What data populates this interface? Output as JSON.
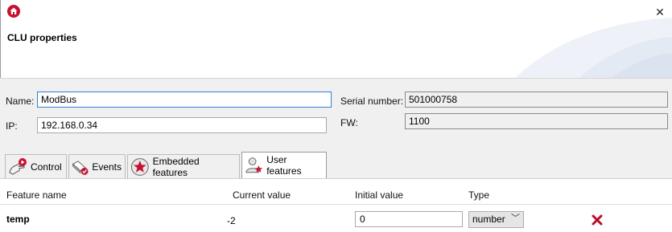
{
  "window": {
    "title": "CLU properties",
    "close_label": "✕"
  },
  "fields": {
    "name_label": "Name:",
    "name_value": "ModBus",
    "ip_label": "IP:",
    "ip_value": "192.168.0.34",
    "serial_label": "Serial number:",
    "serial_value": "501000758",
    "fw_label": "FW:",
    "fw_value": "1100"
  },
  "tabs": [
    {
      "label": "Control",
      "icon": "hand-pointer-icon"
    },
    {
      "label": "Events",
      "icon": "events-icon"
    },
    {
      "label": "Embedded features",
      "icon": "star-badge-icon"
    },
    {
      "label": "User features",
      "icon": "user-star-icon",
      "active": true
    }
  ],
  "table": {
    "columns": [
      "Feature name",
      "Current value",
      "Initial value",
      "Type"
    ],
    "rows": [
      {
        "name": "temp",
        "current": "-2",
        "initial": "0",
        "type": "number"
      }
    ]
  },
  "colors": {
    "accent": "#c8102e",
    "focus": "#2f7fd4",
    "panel": "#f0f0f0"
  }
}
